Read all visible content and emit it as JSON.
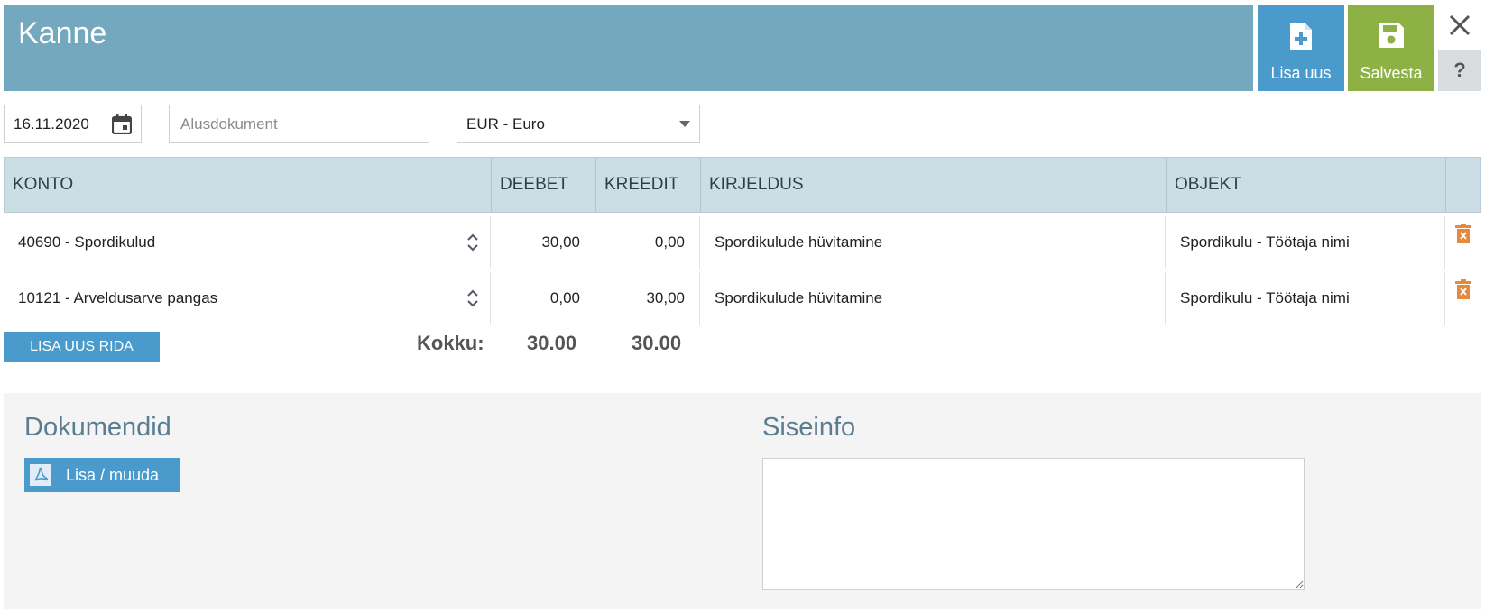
{
  "header": {
    "title": "Kanne"
  },
  "toolbar": {
    "add_label": "Lisa uus",
    "save_label": "Salvesta",
    "close_icon": "close-icon",
    "help_label": "?"
  },
  "form": {
    "date_value": "16.11.2020",
    "document_placeholder": "Alusdokument",
    "document_value": "",
    "currency_value": "EUR - Euro"
  },
  "table": {
    "columns": [
      "KONTO",
      "DEEBET",
      "KREEDIT",
      "KIRJELDUS",
      "OBJEKT"
    ],
    "rows": [
      {
        "konto": "40690 - Spordikulud",
        "deebet": "30,00",
        "kreedit": "0,00",
        "kirjeldus": "Spordikulude hüvitamine",
        "objekt": "Spordikulu - Töötaja nimi"
      },
      {
        "konto": "10121 - Arveldusarve pangas",
        "deebet": "0,00",
        "kreedit": "30,00",
        "kirjeldus": "Spordikulude hüvitamine",
        "objekt": "Spordikulu - Töötaja nimi"
      }
    ],
    "add_row_label": "LISA UUS RIDA",
    "total_label": "Kokku:",
    "total_debit": "30.00",
    "total_credit": "30.00"
  },
  "documents": {
    "title": "Dokumendid",
    "button_label": "Lisa / muuda"
  },
  "internal_info": {
    "title": "Siseinfo",
    "value": ""
  },
  "colors": {
    "header_bg": "#74a8be",
    "primary_button": "#4a9acb",
    "save_button": "#8db144",
    "delete_icon": "#e8893a",
    "table_header_bg": "#cbdde5"
  }
}
